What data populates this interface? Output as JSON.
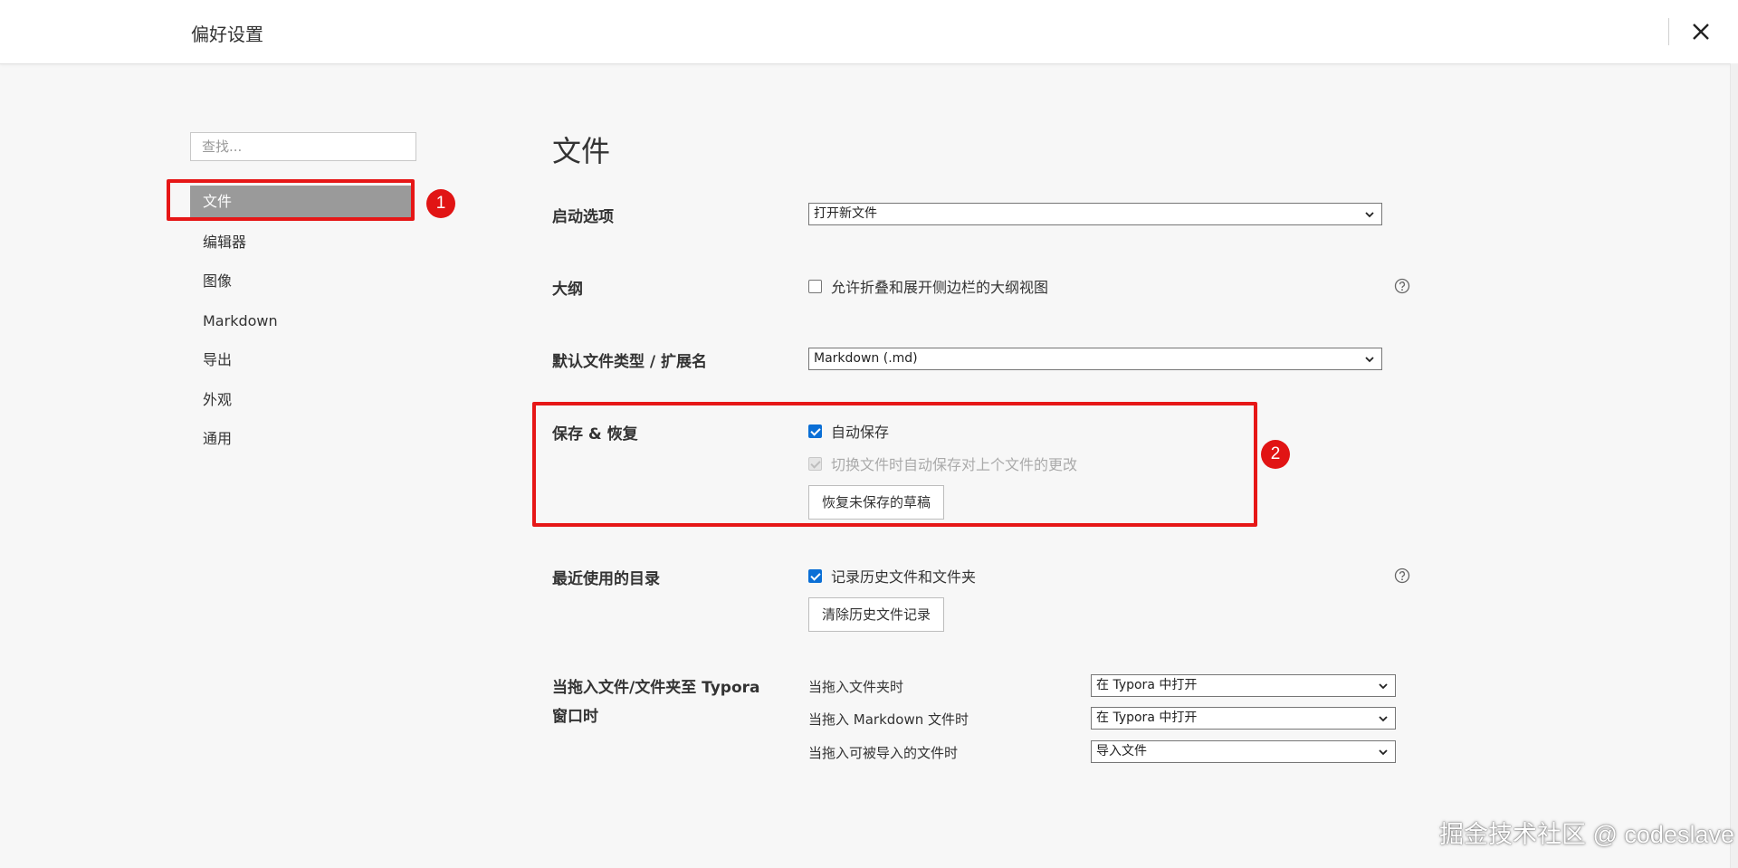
{
  "window": {
    "title": "偏好设置"
  },
  "sidebar": {
    "search_placeholder": "查找...",
    "items": [
      {
        "label": "文件",
        "active": true
      },
      {
        "label": "编辑器"
      },
      {
        "label": "图像"
      },
      {
        "label": "Markdown"
      },
      {
        "label": "导出"
      },
      {
        "label": "外观"
      },
      {
        "label": "通用"
      }
    ]
  },
  "annotations": {
    "badge1": "1",
    "badge2": "2",
    "color": "#e61717"
  },
  "main": {
    "heading": "文件",
    "startup": {
      "label": "启动选项",
      "selected": "打开新文件"
    },
    "outline": {
      "label": "大纲",
      "checkbox": "允许折叠和展开侧边栏的大纲视图",
      "checked": false
    },
    "default_type": {
      "label": "默认文件类型 / 扩展名",
      "selected": "Markdown (.md)"
    },
    "save_restore": {
      "label": "保存 & 恢复",
      "auto_save": "自动保存",
      "auto_save_checked": true,
      "switch_save": "切换文件时自动保存对上个文件的更改",
      "switch_save_disabled": true,
      "restore_button": "恢复未保存的草稿"
    },
    "recent": {
      "label": "最近使用的目录",
      "checkbox": "记录历史文件和文件夹",
      "checked": true,
      "clear_button": "清除历史文件记录"
    },
    "drag": {
      "label": "当拖入文件/文件夹至 Typora 窗口时",
      "rows": [
        {
          "label": "当拖入文件夹时",
          "selected": "在 Typora 中打开"
        },
        {
          "label": "当拖入 Markdown 文件时",
          "selected": "在 Typora 中打开"
        },
        {
          "label": "当拖入可被导入的文件时",
          "selected": "导入文件"
        }
      ]
    }
  },
  "watermark": "掘金技术社区 @ codeslave",
  "colors": {
    "accent": "#0b6fd6",
    "active_nav": "#9a9a9a",
    "annotation": "#e61717"
  }
}
